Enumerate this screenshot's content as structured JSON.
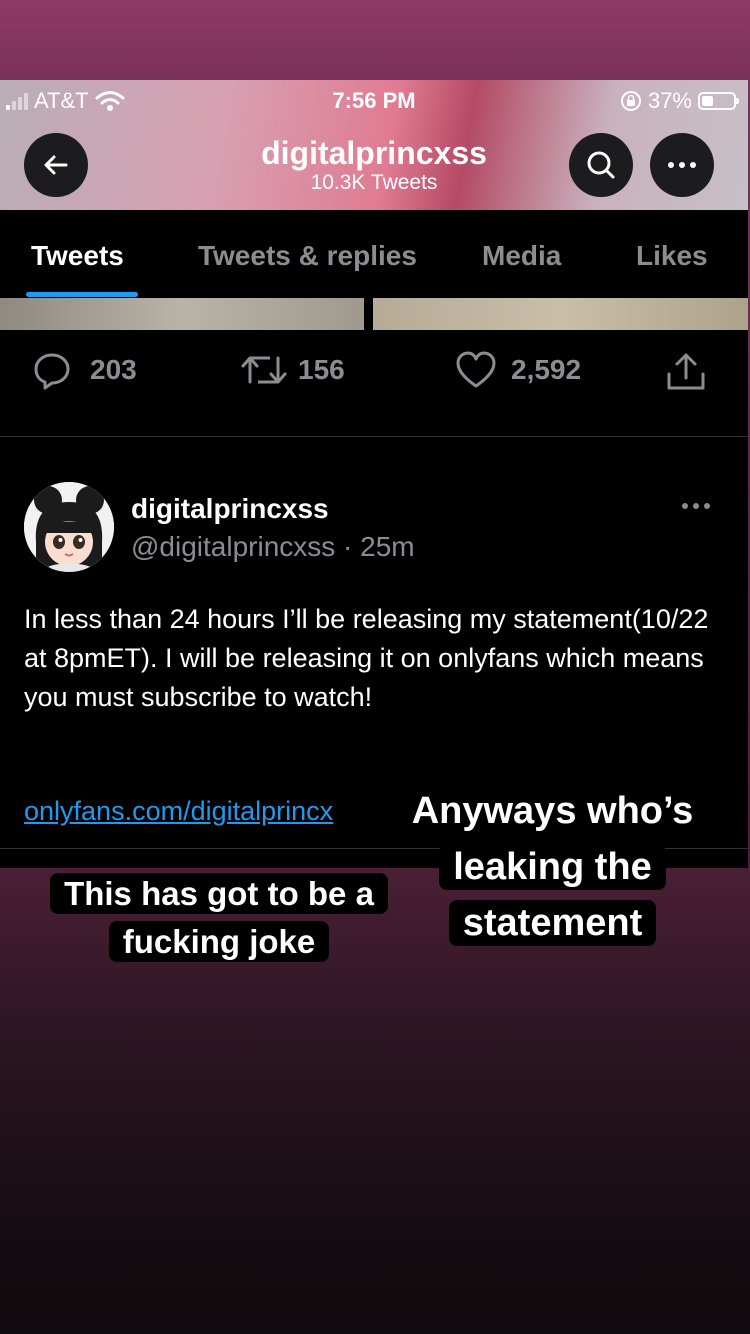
{
  "status_bar": {
    "carrier": "AT&T",
    "time": "7:56 PM",
    "battery": "37%",
    "battery_level": 0.37
  },
  "header": {
    "profile_name": "digitalprincxss",
    "tweet_count": "10.3K Tweets"
  },
  "tabs": [
    {
      "label": "Tweets",
      "active": true
    },
    {
      "label": "Tweets & replies",
      "active": false
    },
    {
      "label": "Media",
      "active": false
    },
    {
      "label": "Likes",
      "active": false
    }
  ],
  "prev_tweet_stats": {
    "replies": "203",
    "retweets": "156",
    "likes": "2,592"
  },
  "tweet": {
    "display_name": "digitalprincxss",
    "handle_time": "@digitalprincxss · 25m",
    "text": "In less than 24 hours I’ll be releasing my statement(10/22 at 8pmET). I will be releasing it on onlyfans which means you must subscribe to watch!",
    "link": "onlyfans.com/digitalprincx"
  },
  "captions": {
    "right": "Anyways who’s leaking the statement",
    "left": "This has got to be a fucking joke"
  },
  "colors": {
    "accent": "#1d9bf0",
    "muted": "#8b8d91",
    "background": "#000000"
  }
}
